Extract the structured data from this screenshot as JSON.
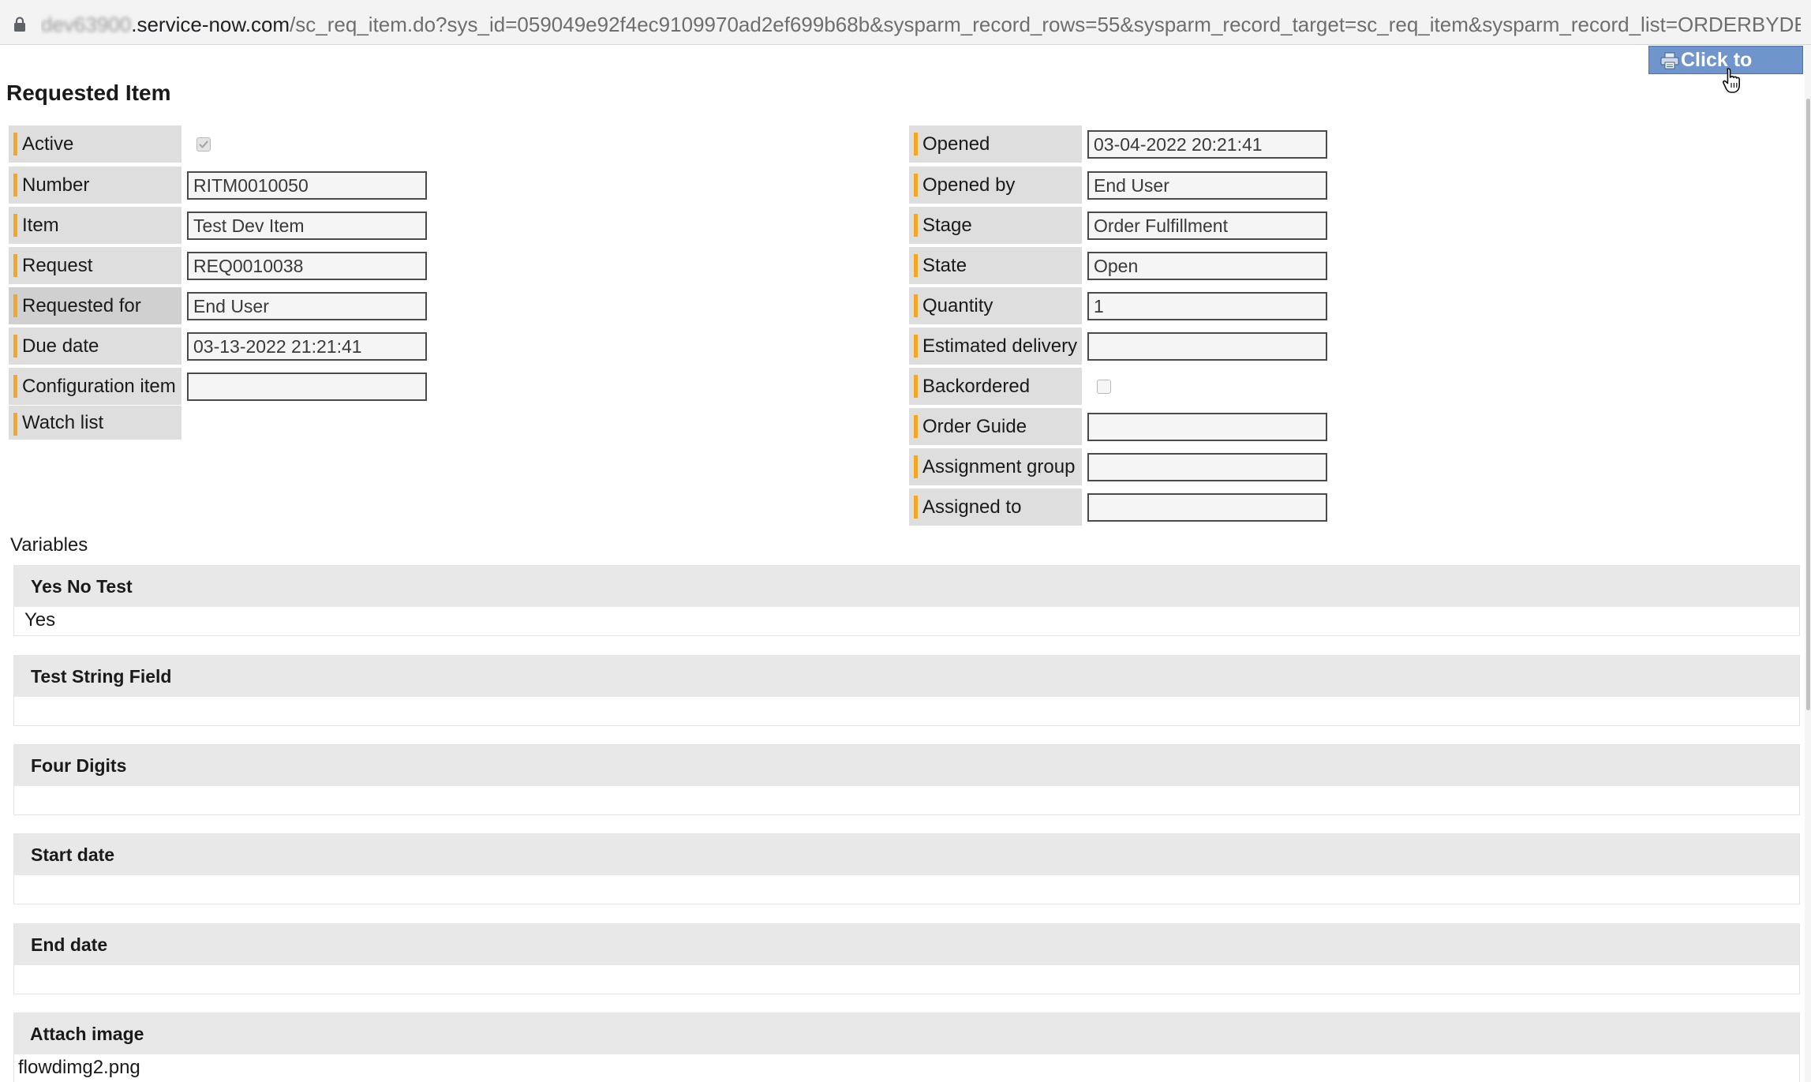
{
  "browser": {
    "url_host_obscured": "dev63900",
    "url_host": ".service-now.com",
    "url_path": "/sc_req_item.do?sys_id=059049e92f4ec9109970ad2ef699b68b&sysparm_record_rows=55&sysparm_record_target=sc_req_item&sysparm_record_list=ORDERBYDESCsys_updated_..."
  },
  "toolbar": {
    "print_label": "Click to Print"
  },
  "page": {
    "title": "Requested Item"
  },
  "left_fields": [
    {
      "label": "Active",
      "type": "checkbox",
      "checked": true
    },
    {
      "label": "Number",
      "type": "text",
      "value": "RITM0010050"
    },
    {
      "label": "Item",
      "type": "text",
      "value": "Test Dev Item"
    },
    {
      "label": "Request",
      "type": "text",
      "value": "REQ0010038"
    },
    {
      "label": "Requested for",
      "type": "text",
      "value": "End User"
    },
    {
      "label": "Due date",
      "type": "text",
      "value": "03-13-2022 21:21:41"
    },
    {
      "label": "Configuration item",
      "type": "text",
      "value": ""
    },
    {
      "label": "Watch list",
      "type": "none"
    }
  ],
  "right_fields": [
    {
      "label": "Opened",
      "type": "text",
      "value": "03-04-2022 20:21:41"
    },
    {
      "label": "Opened by",
      "type": "text",
      "value": "End User"
    },
    {
      "label": "Stage",
      "type": "text",
      "value": "Order Fulfillment"
    },
    {
      "label": "State",
      "type": "text",
      "value": "Open"
    },
    {
      "label": "Quantity",
      "type": "text",
      "value": "1"
    },
    {
      "label": "Estimated delivery",
      "type": "text",
      "value": ""
    },
    {
      "label": "Backordered",
      "type": "checkbox",
      "checked": false
    },
    {
      "label": "Order Guide",
      "type": "text",
      "value": ""
    },
    {
      "label": "Assignment group",
      "type": "text",
      "value": ""
    },
    {
      "label": "Assigned to",
      "type": "text",
      "value": ""
    }
  ],
  "variables": {
    "title": "Variables",
    "items": [
      {
        "label": "Yes No Test",
        "value": "Yes"
      },
      {
        "label": "Test String Field",
        "value": ""
      },
      {
        "label": "Four Digits",
        "value": ""
      },
      {
        "label": "Start date",
        "value": ""
      },
      {
        "label": "End date",
        "value": ""
      },
      {
        "label": "Attach image",
        "value": "flowdimg2.png"
      }
    ]
  }
}
